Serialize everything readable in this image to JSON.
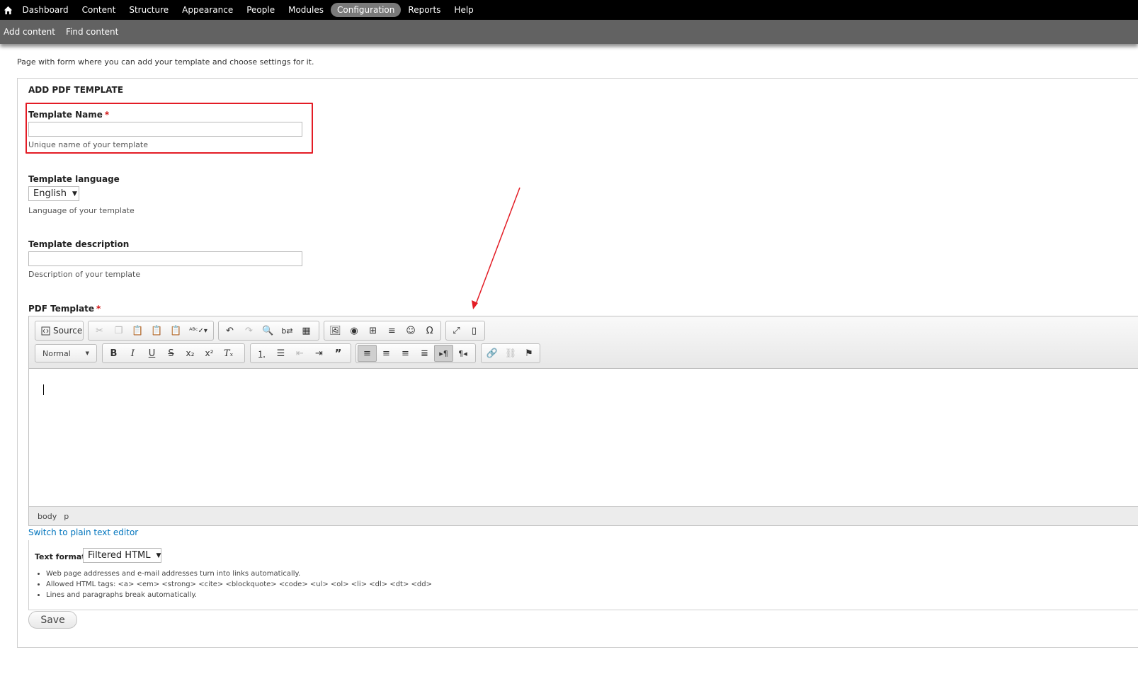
{
  "admin_menu": {
    "home_icon": "home-icon",
    "items": [
      {
        "label": "Dashboard",
        "active": false
      },
      {
        "label": "Content",
        "active": false
      },
      {
        "label": "Structure",
        "active": false
      },
      {
        "label": "Appearance",
        "active": false
      },
      {
        "label": "People",
        "active": false
      },
      {
        "label": "Modules",
        "active": false
      },
      {
        "label": "Configuration",
        "active": true
      },
      {
        "label": "Reports",
        "active": false
      },
      {
        "label": "Help",
        "active": false
      }
    ]
  },
  "shortcuts": [
    "Add content",
    "Find content"
  ],
  "page": {
    "intro": "Page with form where you can add your template and choose settings for it."
  },
  "form": {
    "title": "ADD PDF TEMPLATE",
    "required_marker": "*",
    "template_name": {
      "label": "Template Name",
      "value": "",
      "description": "Unique name of your template"
    },
    "template_language": {
      "label": "Template language",
      "selected": "English",
      "description": "Language of your template"
    },
    "template_description": {
      "label": "Template description",
      "value": "",
      "description": "Description of your template"
    },
    "pdf_template": {
      "label": "PDF Template"
    },
    "switch_link": "Switch to plain text editor",
    "text_format": {
      "label": "Text format",
      "selected": "Filtered HTML",
      "tips": [
        "Web page addresses and e-mail addresses turn into links automatically.",
        "Allowed HTML tags: <a> <em> <strong> <cite> <blockquote> <code> <ul> <ol> <li> <dl> <dt> <dd>",
        "Lines and paragraphs break automatically."
      ]
    },
    "save_label": "Save"
  },
  "editor": {
    "source_label": "Source",
    "format_combo": "Normal",
    "path": [
      "body",
      "p"
    ]
  },
  "colors": {
    "highlight": "#e31c25",
    "annotation_arrow": "#e31c25",
    "link": "#0074bd",
    "required": "#d21515"
  }
}
